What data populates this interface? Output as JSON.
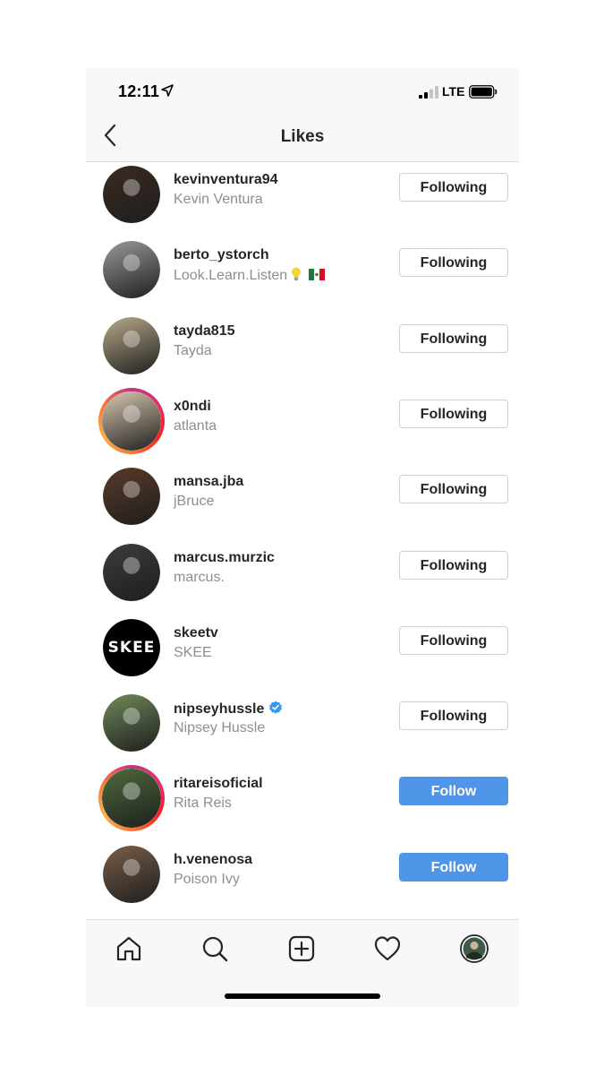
{
  "status_bar": {
    "time": "12:11",
    "network": "LTE"
  },
  "header": {
    "title": "Likes"
  },
  "users": [
    {
      "username": "kevinventura94",
      "fullname": "Kevin Ventura",
      "button": "Following",
      "verified": false,
      "story": false,
      "avatar_color": "#3b2a20"
    },
    {
      "username": "berto_ystorch",
      "fullname": "Look.Learn.Listen",
      "button": "Following",
      "verified": false,
      "story": false,
      "avatar_color": "#9a9a9a"
    },
    {
      "username": "tayda815",
      "fullname": "Tayda",
      "button": "Following",
      "verified": false,
      "story": false,
      "avatar_color": "#b8a98a"
    },
    {
      "username": "x0ndi",
      "fullname": "atlanta",
      "button": "Following",
      "verified": false,
      "story": true,
      "avatar_color": "#d9c9b0"
    },
    {
      "username": "mansa.jba",
      "fullname": "jBruce",
      "button": "Following",
      "verified": false,
      "story": false,
      "avatar_color": "#5a3a28"
    },
    {
      "username": "marcus.murzic",
      "fullname": "marcus.",
      "button": "Following",
      "verified": false,
      "story": false,
      "avatar_color": "#3c3c3c"
    },
    {
      "username": "skeetv",
      "fullname": "SKEE",
      "button": "Following",
      "verified": false,
      "story": false,
      "avatar_color": "#000000",
      "logo_text": "SKEE"
    },
    {
      "username": "nipseyhussle",
      "fullname": "Nipsey Hussle",
      "button": "Following",
      "verified": true,
      "story": false,
      "avatar_color": "#6f8a5a"
    },
    {
      "username": "ritareisoficial",
      "fullname": "Rita Reis",
      "button": "Follow",
      "verified": false,
      "story": true,
      "avatar_color": "#4e6b3c"
    },
    {
      "username": "h.venenosa",
      "fullname": "Poison Ivy",
      "button": "Follow",
      "verified": false,
      "story": false,
      "avatar_color": "#7a5e48"
    }
  ],
  "colors": {
    "follow_blue": "#4f95e8",
    "text_primary": "#262626",
    "text_secondary": "#8e8e8e",
    "verified_blue": "#3897f0"
  },
  "tabs": [
    "home-icon",
    "search-icon",
    "new-post-icon",
    "activity-heart-icon",
    "profile-avatar"
  ]
}
